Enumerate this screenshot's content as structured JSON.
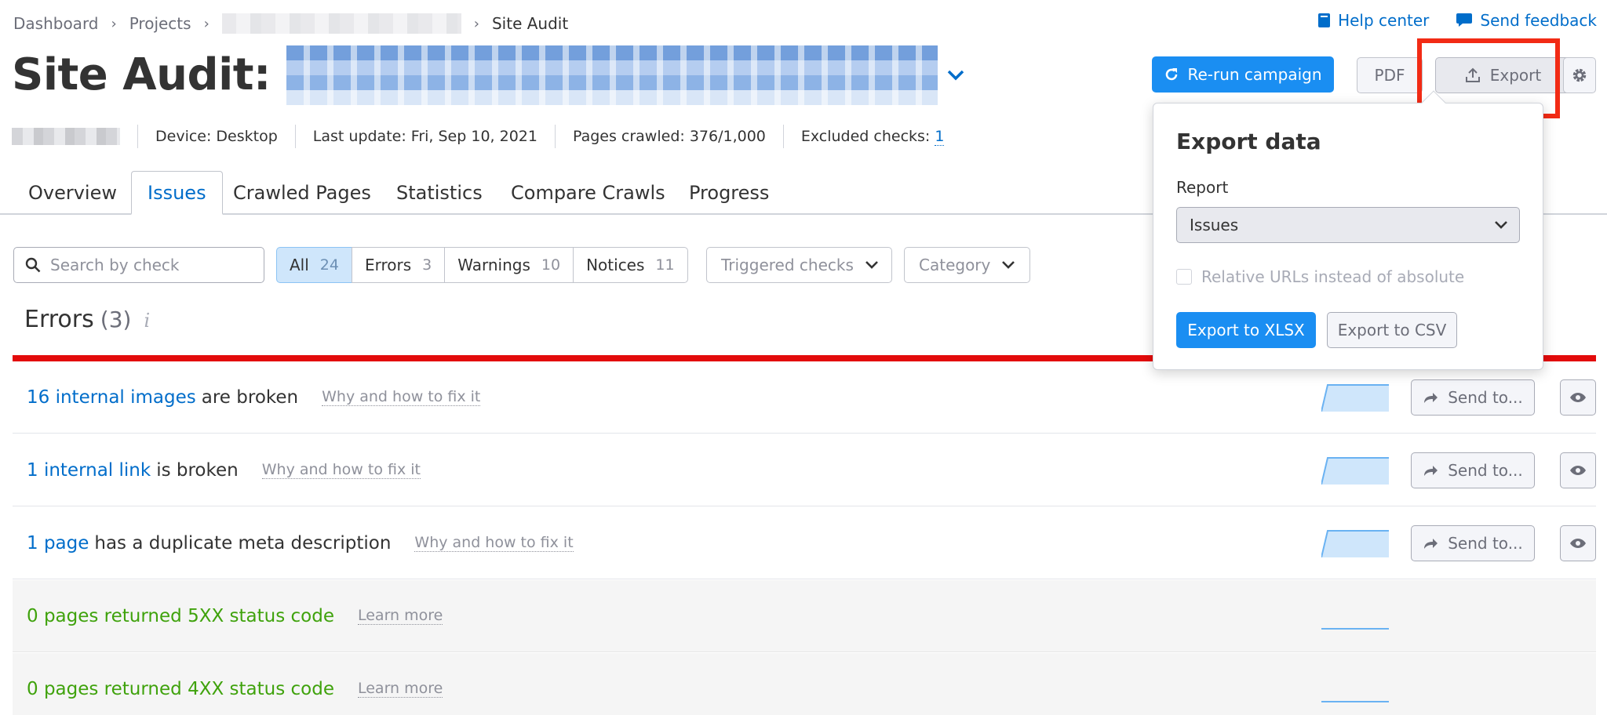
{
  "breadcrumb": {
    "items": [
      "Dashboard",
      "Projects"
    ],
    "current": "Site Audit"
  },
  "top_links": {
    "help_center": "Help center",
    "send_feedback": "Send feedback"
  },
  "title": {
    "prefix": "Site Audit:"
  },
  "toolbar": {
    "rerun": "Re-run campaign",
    "pdf": "PDF",
    "export": "Export"
  },
  "info": {
    "device": "Device: Desktop",
    "last_update": "Last update: Fri, Sep 10, 2021",
    "pages_crawled": "Pages crawled: 376/1,000",
    "excluded_label": "Excluded checks:",
    "excluded_value": "1"
  },
  "tabs": [
    "Overview",
    "Issues",
    "Crawled Pages",
    "Statistics",
    "Compare Crawls",
    "Progress"
  ],
  "filters": {
    "search_placeholder": "Search by check",
    "segments": [
      {
        "label": "All",
        "count": "24"
      },
      {
        "label": "Errors",
        "count": "3"
      },
      {
        "label": "Warnings",
        "count": "10"
      },
      {
        "label": "Notices",
        "count": "11"
      }
    ],
    "triggered": "Triggered checks",
    "category": "Category"
  },
  "errors": {
    "heading": "Errors",
    "count": "(3)",
    "info": "i"
  },
  "rows": [
    {
      "link": "16 internal images",
      "text": "are broken",
      "help": "Why and how to fix it",
      "send": "Send to..."
    },
    {
      "link": "1 internal link",
      "text": "is broken",
      "help": "Why and how to fix it",
      "send": "Send to..."
    },
    {
      "link": "1 page",
      "text": "has a duplicate meta description",
      "help": "Why and how to fix it",
      "send": "Send to..."
    },
    {
      "text": "0 pages returned 5XX status code",
      "help": "Learn more"
    },
    {
      "text": "0 pages returned 4XX status code",
      "help": "Learn more"
    }
  ],
  "export_popover": {
    "title": "Export data",
    "report_label": "Report",
    "report_value": "Issues",
    "relative_urls": "Relative URLs instead of absolute",
    "xlsx": "Export to XLSX",
    "csv": "Export to CSV"
  },
  "colors": {
    "primary": "#1a8ef2",
    "link": "#006dca",
    "error": "#e30b0b",
    "success": "#3fa20c",
    "highlight": "#f22b15"
  }
}
